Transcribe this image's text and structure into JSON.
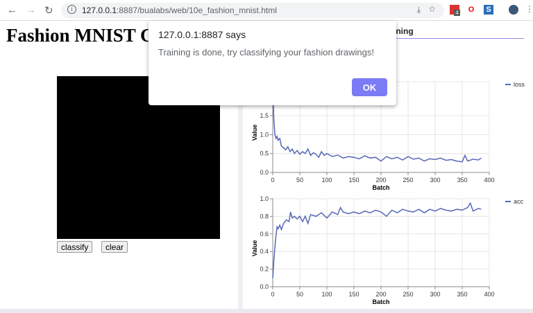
{
  "browser": {
    "url_host": "127.0.0.1",
    "url_rest": ":8887/bualabs/web/10e_fashion_mnist.html",
    "ext_badge": "4"
  },
  "page": {
    "heading": "Fashion MNIST Classifier",
    "classify_label": "classify",
    "clear_label": "clear"
  },
  "visor": {
    "tab_title": "Training"
  },
  "dialog": {
    "title": "127.0.0.1:8887 says",
    "message": "Training is done, try classifying your fashion drawings!",
    "ok_label": "OK",
    "ok_color": "#7b7bf5"
  },
  "chart_data": [
    {
      "type": "line",
      "xlabel": "Batch",
      "ylabel": "Value",
      "xlim": [
        0,
        400
      ],
      "ylim": [
        0,
        2.4
      ],
      "xticks": [
        0,
        50,
        100,
        150,
        200,
        250,
        300,
        350,
        400
      ],
      "yticks": [
        "0.0",
        "0.5",
        "1.0",
        "1.5"
      ],
      "grid": true,
      "legend": "top-right",
      "series": [
        {
          "name": "loss",
          "color": "#5567b5",
          "x": [
            0,
            2,
            4,
            6,
            8,
            10,
            13,
            16,
            20,
            24,
            28,
            32,
            36,
            40,
            45,
            50,
            55,
            60,
            65,
            70,
            75,
            80,
            85,
            90,
            95,
            100,
            110,
            120,
            130,
            140,
            150,
            160,
            170,
            180,
            190,
            200,
            210,
            220,
            230,
            240,
            250,
            260,
            270,
            280,
            290,
            300,
            310,
            320,
            330,
            340,
            350,
            355,
            360,
            370,
            380,
            385
          ],
          "y": [
            2.3,
            1.4,
            1.0,
            0.9,
            0.95,
            0.85,
            0.9,
            0.7,
            0.65,
            0.6,
            0.68,
            0.55,
            0.62,
            0.5,
            0.58,
            0.48,
            0.55,
            0.5,
            0.62,
            0.45,
            0.52,
            0.48,
            0.4,
            0.55,
            0.45,
            0.5,
            0.42,
            0.46,
            0.38,
            0.42,
            0.4,
            0.36,
            0.44,
            0.38,
            0.4,
            0.3,
            0.42,
            0.36,
            0.4,
            0.33,
            0.42,
            0.35,
            0.38,
            0.3,
            0.36,
            0.34,
            0.38,
            0.32,
            0.34,
            0.3,
            0.28,
            0.45,
            0.3,
            0.35,
            0.33,
            0.38
          ]
        }
      ]
    },
    {
      "type": "line",
      "xlabel": "Batch",
      "ylabel": "Value",
      "xlim": [
        0,
        400
      ],
      "ylim": [
        0,
        1.0
      ],
      "xticks": [
        0,
        50,
        100,
        150,
        200,
        250,
        300,
        350,
        400
      ],
      "yticks": [
        "0.0",
        "0.2",
        "0.4",
        "0.6",
        "0.8",
        "1.0"
      ],
      "grid": true,
      "legend": "top-right",
      "series": [
        {
          "name": "acc",
          "color": "#5567b5",
          "x": [
            0,
            2,
            4,
            6,
            8,
            10,
            13,
            16,
            20,
            25,
            30,
            33,
            36,
            40,
            45,
            50,
            55,
            60,
            65,
            70,
            80,
            90,
            100,
            110,
            120,
            125,
            130,
            140,
            150,
            160,
            170,
            180,
            190,
            200,
            210,
            220,
            230,
            240,
            250,
            260,
            270,
            280,
            290,
            300,
            310,
            320,
            330,
            340,
            350,
            360,
            365,
            370,
            380,
            385
          ],
          "y": [
            0.1,
            0.3,
            0.45,
            0.58,
            0.68,
            0.66,
            0.7,
            0.65,
            0.72,
            0.76,
            0.74,
            0.85,
            0.78,
            0.8,
            0.77,
            0.8,
            0.74,
            0.8,
            0.72,
            0.82,
            0.8,
            0.84,
            0.78,
            0.85,
            0.82,
            0.9,
            0.85,
            0.83,
            0.85,
            0.83,
            0.86,
            0.84,
            0.87,
            0.85,
            0.8,
            0.87,
            0.84,
            0.88,
            0.86,
            0.85,
            0.88,
            0.84,
            0.88,
            0.86,
            0.89,
            0.87,
            0.86,
            0.88,
            0.87,
            0.9,
            0.95,
            0.86,
            0.89,
            0.88
          ]
        }
      ]
    }
  ]
}
